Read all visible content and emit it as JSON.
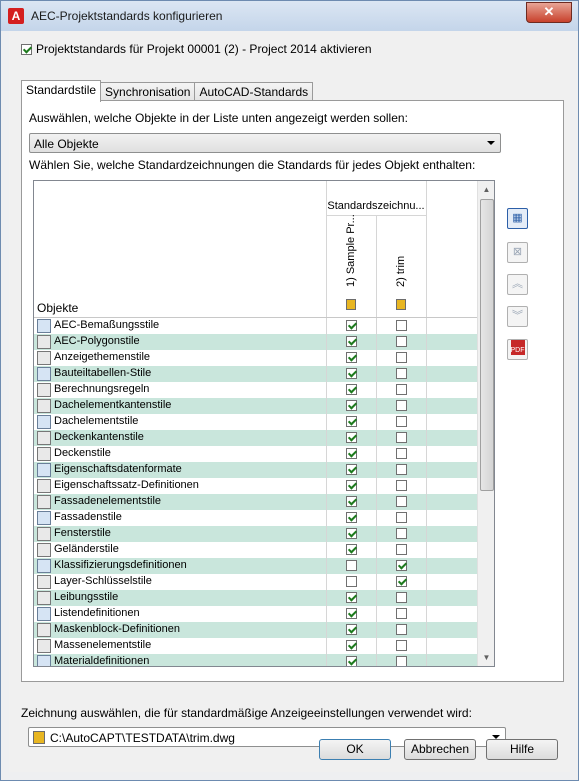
{
  "window": {
    "title": "AEC-Projektstandards konfigurieren",
    "app_icon": "A",
    "close_glyph": "✕"
  },
  "activate": {
    "checked": true,
    "label": "Projektstandards für Projekt 00001 (2) - Project 2014 aktivieren"
  },
  "tabs": [
    {
      "label": "Standardstile",
      "active": true
    },
    {
      "label": "Synchronisation",
      "active": false
    },
    {
      "label": "AutoCAD-Standards",
      "active": false
    }
  ],
  "filter": {
    "label": "Auswählen, welche Objekte in der Liste unten angezeigt werden sollen:",
    "value": "Alle Objekte"
  },
  "grid": {
    "label": "Wählen Sie, welche Standardzeichnungen die Standards für jedes Objekt enthalten:",
    "objects_header": "Objekte",
    "group_header": "Standardszeichnu...",
    "columns": [
      "1) Sample Pr...",
      "2) trim"
    ],
    "rows": [
      {
        "name": "AEC-Bemaßungsstile",
        "c1": true,
        "c2": false,
        "icon": "dimension-icon"
      },
      {
        "name": "AEC-Polygonstile",
        "c1": true,
        "c2": false,
        "icon": "polygon-icon"
      },
      {
        "name": "Anzeigethemenstile",
        "c1": true,
        "c2": false,
        "icon": "display-theme-icon"
      },
      {
        "name": "Bauteiltabellen-Stile",
        "c1": true,
        "c2": false,
        "icon": "schedule-table-icon"
      },
      {
        "name": "Berechnungsregeln",
        "c1": true,
        "c2": false,
        "icon": "calculation-icon"
      },
      {
        "name": "Dachelementkantenstile",
        "c1": true,
        "c2": false,
        "icon": "roof-slab-edge-icon"
      },
      {
        "name": "Dachelementstile",
        "c1": true,
        "c2": false,
        "icon": "roof-slab-icon"
      },
      {
        "name": "Deckenkantenstile",
        "c1": true,
        "c2": false,
        "icon": "slab-edge-icon"
      },
      {
        "name": "Deckenstile",
        "c1": true,
        "c2": false,
        "icon": "slab-icon"
      },
      {
        "name": "Eigenschaftsdatenformate",
        "c1": true,
        "c2": false,
        "icon": "property-format-icon"
      },
      {
        "name": "Eigenschaftssatz-Definitionen",
        "c1": true,
        "c2": false,
        "icon": "property-set-icon"
      },
      {
        "name": "Fassadenelementstile",
        "c1": true,
        "c2": false,
        "icon": "curtain-wall-unit-icon"
      },
      {
        "name": "Fassadenstile",
        "c1": true,
        "c2": false,
        "icon": "curtain-wall-icon"
      },
      {
        "name": "Fensterstile",
        "c1": true,
        "c2": false,
        "icon": "window-icon"
      },
      {
        "name": "Geländerstile",
        "c1": true,
        "c2": false,
        "icon": "railing-icon"
      },
      {
        "name": "Klassifizierungsdefinitionen",
        "c1": false,
        "c2": true,
        "icon": "classification-icon"
      },
      {
        "name": "Layer-Schlüsselstile",
        "c1": false,
        "c2": true,
        "icon": "layer-key-icon"
      },
      {
        "name": "Leibungsstile",
        "c1": true,
        "c2": false,
        "icon": "opening-icon"
      },
      {
        "name": "Listendefinitionen",
        "c1": true,
        "c2": false,
        "icon": "list-icon"
      },
      {
        "name": "Maskenblock-Definitionen",
        "c1": true,
        "c2": false,
        "icon": "mask-block-icon"
      },
      {
        "name": "Massenelementstile",
        "c1": true,
        "c2": false,
        "icon": "mass-element-icon"
      },
      {
        "name": "Materialdefinitionen",
        "c1": true,
        "c2": false,
        "icon": "material-icon"
      }
    ]
  },
  "display_drawing": {
    "label": "Zeichnung auswählen, die für standardmäßige Anzeigeeinstellungen verwendet wird:",
    "value": "C:\\AutoCAPT\\TESTDATA\\trim.dwg"
  },
  "side_buttons": [
    "add-drawing-icon",
    "remove-drawing-icon",
    "move-up-icon",
    "move-down-icon",
    "pdf-report-icon"
  ],
  "side_pdf_text": "PDF",
  "buttons": {
    "ok": "OK",
    "cancel": "Abbrechen",
    "help": "Hilfe"
  },
  "colors": {
    "row_alt": "#c9e6dc",
    "check": "#1d7a1d",
    "titlebar": "#c4d5ea"
  }
}
